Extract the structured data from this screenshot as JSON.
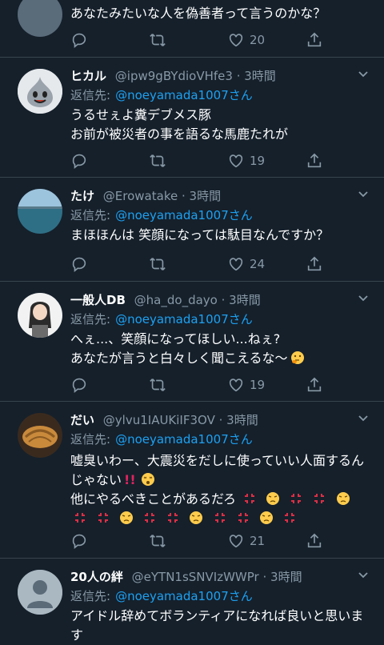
{
  "tweets": [
    {
      "name": "",
      "handle": "",
      "time": "",
      "reply_label": "",
      "reply_to": "",
      "lines": [
        "あなたみたいな人を偽善者って言うのかな？"
      ],
      "likes": "20"
    },
    {
      "name": "ヒカル",
      "handle": "@ipw9gBYdioVHfe3",
      "time": "· 3時間",
      "reply_label": "返信先:",
      "reply_to": "@noeyamada1007さん",
      "lines": [
        "うるせぇよ糞デブメス豚",
        "お前が被災者の事を語るな馬鹿たれが"
      ],
      "likes": "19"
    },
    {
      "name": "たけ",
      "handle": "@Erowatake",
      "time": "· 3時間",
      "reply_label": "返信先:",
      "reply_to": "@noeyamada1007さん",
      "lines": [
        "まほほんは 笑顔になっては駄目なんですか？"
      ],
      "likes": "24"
    },
    {
      "name": "一般人DB",
      "handle": "@ha_do_dayo",
      "time": "· 3時間",
      "reply_label": "返信先:",
      "reply_to": "@noeyamada1007さん",
      "lines": [
        "へぇ...、笑顔になってほしい...ねぇ?",
        "あなたが言うと白々しく聞こえるな〜"
      ],
      "likes": "19"
    },
    {
      "name": "だい",
      "handle": "@ylvu1IAUKiIF3OV",
      "time": "· 3時間",
      "reply_label": "返信先:",
      "reply_to": "@noeyamada1007さん",
      "lines": [
        "嘘臭いわー、大震災をだしに使っていい人面するん",
        "じゃない",
        "他にやるべきことがあるだろ",
        ""
      ],
      "likes": "21"
    },
    {
      "name": "20人の絆",
      "handle": "@eYTN1sSNVIzWWPr",
      "time": "· 3時間",
      "reply_label": "返信先:",
      "reply_to": "@noeyamada1007さん",
      "lines": [
        "アイドル辞めてボランティアになれば良いと思いま",
        "す"
      ],
      "likes": ""
    }
  ],
  "colors": {
    "background": "#15202b",
    "mention": "#1da1f2",
    "secondary": "#8899a6",
    "divider": "#38444d"
  },
  "icons": [
    "reply-icon",
    "retweet-icon",
    "like-icon",
    "share-icon",
    "chevron-down-icon"
  ]
}
